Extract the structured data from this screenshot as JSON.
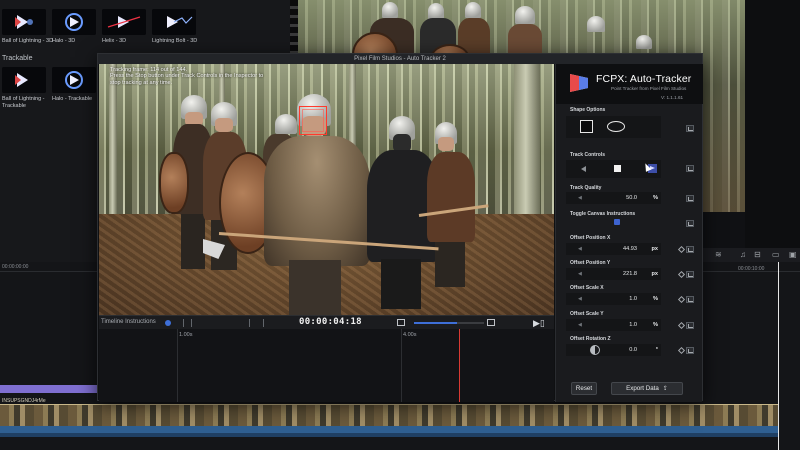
{
  "host": {
    "browser": {
      "sections": [
        "Trackable"
      ],
      "effects_row1": [
        {
          "label": "Ball of Lightning - 3D"
        },
        {
          "label": "Halo - 3D"
        },
        {
          "label": "Helix - 3D"
        },
        {
          "label": "Lightning Bolt - 3D"
        }
      ],
      "effects_row2": [
        {
          "label": "Ball of Lightning - Trackable"
        },
        {
          "label": "Halo - Trackable"
        }
      ]
    },
    "timeline": {
      "ruler_left": "00:00:00:00",
      "ruler_right": "00:00:10:00",
      "clip_label": "INSUPSGNDJ4rMe"
    }
  },
  "plugin": {
    "window_title": "Pixel Film Studios - Auto Tracker 2",
    "instructions": {
      "line1": "Tracking frame: 114 out of 144.",
      "line2": "Press the Stop button under Track Controls in the Inspector to",
      "line3": "stop tracking at any time."
    },
    "transport": {
      "label": "Timeline Instructions",
      "timecode": "00:00:04:18",
      "slider_fraction": 0.62
    },
    "timeline": {
      "mark1": "1.00s",
      "mark2": "4.00s"
    },
    "inspector": {
      "title": "FCPX: Auto-Tracker",
      "subtitle": "Point Tracker from Pixel Film Studios",
      "version": "V: 1.1.1.61",
      "sections": {
        "shape_options": "Shape Options",
        "track_controls": "Track Controls",
        "track_quality": "Track Quality",
        "toggle_canvas": "Toggle Canvas Instructions",
        "offset_x": "Offset Position X",
        "offset_y": "Offset Position Y",
        "scale_x": "Offset Scale X",
        "scale_y": "Offset Scale Y",
        "rotation_z": "Offset Rotation Z"
      },
      "values": {
        "track_quality": "50.0",
        "track_quality_unit": "%",
        "offset_x": "44.93",
        "offset_x_unit": "px",
        "offset_y": "221.8",
        "offset_y_unit": "px",
        "scale_x": "1.0",
        "scale_x_unit": "%",
        "scale_y": "1.0",
        "scale_y_unit": "%",
        "rotation_z": "0.0",
        "rotation_z_unit": "°"
      },
      "buttons": {
        "reset": "Reset",
        "export": "Export Data"
      }
    }
  },
  "colors": {
    "accent": "#3e6fd8",
    "tracker_box": "#ff3a2d",
    "playhead_red": "#d93a33"
  }
}
